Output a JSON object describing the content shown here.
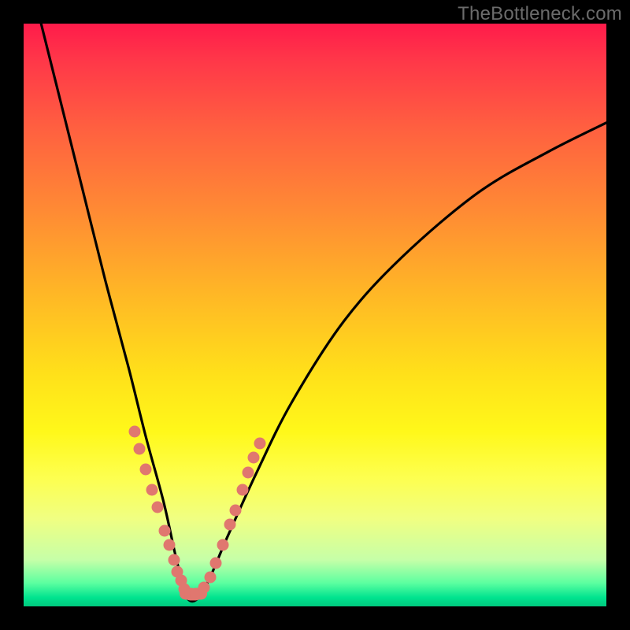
{
  "watermark": "TheBottleneck.com",
  "colors": {
    "dot": "#e0776f",
    "curve": "#000000",
    "frame": "#000000"
  },
  "chart_data": {
    "type": "line",
    "title": "",
    "xlabel": "",
    "ylabel": "",
    "xlim": [
      0,
      100
    ],
    "ylim": [
      0,
      100
    ],
    "note": "Bottleneck-style V curve; axes are percent-like with no visible tick labels. Minimum at roughly x≈28, y≈0. Left branch falls from top-left; right branch rises toward upper right more gradually.",
    "series": [
      {
        "name": "bottleneck-curve",
        "x": [
          3,
          6,
          10,
          14,
          18,
          21,
          24,
          26,
          27.5,
          28.5,
          30,
          32,
          35,
          40,
          46,
          55,
          65,
          78,
          90,
          100
        ],
        "y": [
          100,
          88,
          72,
          56,
          41,
          29,
          18,
          9,
          3,
          1,
          1.5,
          5,
          12,
          23,
          35,
          49,
          60,
          71,
          78,
          83
        ]
      }
    ],
    "marker_points": {
      "name": "highlight-dots",
      "note": "Dots cluster along both branches near the trough, roughly y in [3,30].",
      "points": [
        {
          "x": 19.0,
          "y": 30.0
        },
        {
          "x": 19.8,
          "y": 27.0
        },
        {
          "x": 21.0,
          "y": 23.5
        },
        {
          "x": 22.0,
          "y": 20.0
        },
        {
          "x": 23.0,
          "y": 17.0
        },
        {
          "x": 24.2,
          "y": 13.0
        },
        {
          "x": 25.0,
          "y": 10.5
        },
        {
          "x": 25.8,
          "y": 8.0
        },
        {
          "x": 26.4,
          "y": 6.0
        },
        {
          "x": 27.0,
          "y": 4.5
        },
        {
          "x": 27.5,
          "y": 3.0
        },
        {
          "x": 28.3,
          "y": 2.2
        },
        {
          "x": 29.0,
          "y": 2.0
        },
        {
          "x": 30.0,
          "y": 2.2
        },
        {
          "x": 31.0,
          "y": 3.2
        },
        {
          "x": 32.0,
          "y": 5.0
        },
        {
          "x": 33.0,
          "y": 7.5
        },
        {
          "x": 34.2,
          "y": 10.5
        },
        {
          "x": 35.4,
          "y": 14.0
        },
        {
          "x": 36.3,
          "y": 16.5
        },
        {
          "x": 37.5,
          "y": 20.0
        },
        {
          "x": 38.5,
          "y": 23.0
        },
        {
          "x": 39.5,
          "y": 25.5
        },
        {
          "x": 40.5,
          "y": 28.0
        }
      ]
    }
  }
}
